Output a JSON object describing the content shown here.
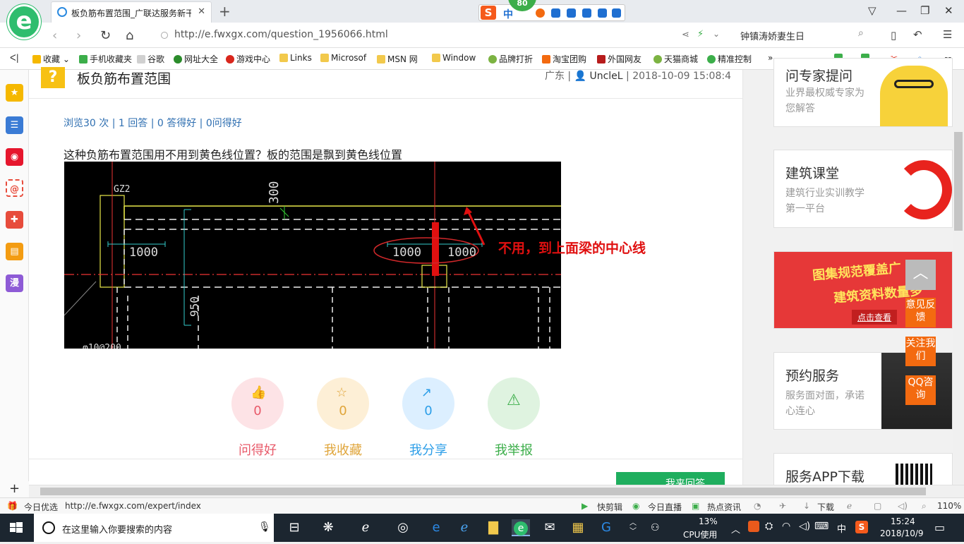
{
  "browser": {
    "tab_title": "板负筋布置范围_广联达服务新干线",
    "tab_close": "✕",
    "new_tab": "+",
    "ime_badge": "80",
    "ime_lang": "中",
    "ime_logo": "S",
    "url": "http://e.fwxgx.com/question_1956066.html",
    "search_text": "钟镇涛娇妻生日",
    "window_controls": [
      "▽",
      "—",
      "❐",
      "✕"
    ]
  },
  "bookmarks": [
    {
      "label": "收藏",
      "color": "#f5b800"
    },
    {
      "label": "手机收藏夹",
      "color": "#3cae4a"
    },
    {
      "label": "谷歌",
      "color": "#d0d0d0"
    },
    {
      "label": "网址大全",
      "color": "#2b8c2b"
    },
    {
      "label": "游戏中心",
      "color": "#d9261c"
    },
    {
      "label": "Links",
      "color": "#f2c94c"
    },
    {
      "label": "Microsof",
      "color": "#f2c94c"
    },
    {
      "label": "MSN 网",
      "color": "#f2c94c"
    },
    {
      "label": "Window",
      "color": "#f2c94c"
    },
    {
      "label": "品牌打折",
      "color": "#7cb342"
    },
    {
      "label": "淘宝团购",
      "color": "#f36a10"
    },
    {
      "label": "外国网友",
      "color": "#b71c1c"
    },
    {
      "label": "天猫商城",
      "color": "#7cb342"
    },
    {
      "label": "精准控制",
      "color": "#3cae4a"
    }
  ],
  "bookmarks_more": "»",
  "bookmarks_collapse": "ᐸ|",
  "left_sidebar": [
    {
      "name": "favorites-icon",
      "color": "#f5b800",
      "glyph": "★"
    },
    {
      "name": "apps-icon",
      "color": "#3a7bd5",
      "glyph": "☰"
    },
    {
      "name": "weibo-icon",
      "color": "#e6162d",
      "glyph": "◉"
    },
    {
      "name": "mail-icon",
      "color": "#e74c3c",
      "glyph": "@"
    },
    {
      "name": "game-icon",
      "color": "#e74c3c",
      "glyph": "✚"
    },
    {
      "name": "notes-icon",
      "color": "#f39c12",
      "glyph": "▤"
    },
    {
      "name": "comic-icon",
      "color": "#8e5bd6",
      "glyph": "漫"
    }
  ],
  "question": {
    "icon": "?",
    "title": "板负筋布置范围",
    "region": "广东",
    "user": "UncleL",
    "time": "2018-10-09 15:08:4",
    "stats": "浏览30 次 | 1 回答 | 0 答得好 | 0问得好",
    "body": "这种负筋布置范围用不用到黄色线位置？板的范围是飘到黄色线位置"
  },
  "cad": {
    "label_gz2": "GZ2",
    "label_300": "300",
    "label_950": "950",
    "label_1000_a": "1000",
    "label_1000_b": "1000",
    "label_1000_c": "1000",
    "label_bottom": "φ10@200",
    "annotation": "不用，到上面梁的中心线"
  },
  "actions": [
    {
      "label": "问得好",
      "count": "0",
      "color": "#e85a6a",
      "bg": "#fde3e6",
      "glyph": "👍"
    },
    {
      "label": "我收藏",
      "count": "0",
      "color": "#e0a53a",
      "bg": "#fdefd6",
      "glyph": "☆"
    },
    {
      "label": "我分享",
      "count": "0",
      "color": "#2c9ee8",
      "bg": "#dcefff",
      "glyph": "↗"
    },
    {
      "label": "我举报",
      "count": "",
      "color": "#3cae4a",
      "bg": "#dff3e0",
      "glyph": "⚠"
    }
  ],
  "answer_button": "我来回答",
  "right_cards": [
    {
      "title": "问专家提问",
      "desc": "业界最权威专家为您解答"
    },
    {
      "title": "建筑课堂",
      "desc": "建筑行业实训教学第一平台"
    },
    {
      "title": "",
      "desc": ""
    },
    {
      "title": "预约服务",
      "desc": "服务面对面，承诺心连心"
    },
    {
      "title": "服务APP下载",
      "desc": ""
    }
  ],
  "banner": {
    "line1": "图集规范覆盖广",
    "line2": "建筑资料数量多",
    "cta": "点击查看"
  },
  "float_buttons": [
    {
      "label": "意见反馈"
    },
    {
      "label": "关注我们"
    },
    {
      "label": "QQ咨询"
    }
  ],
  "back_to_top": "︿",
  "status": {
    "left_label": "今日优选",
    "url": "http://e.fwxgx.com/expert/index",
    "items": [
      "快剪辑",
      "今日直播",
      "热点资讯",
      "下载"
    ],
    "zoom": "110%"
  },
  "taskbar": {
    "search_placeholder": "在这里输入你要搜索的内容",
    "cpu": "13%",
    "cpu_label": "CPU使用",
    "ime": "中",
    "time": "15:24",
    "date": "2018/10/9"
  }
}
